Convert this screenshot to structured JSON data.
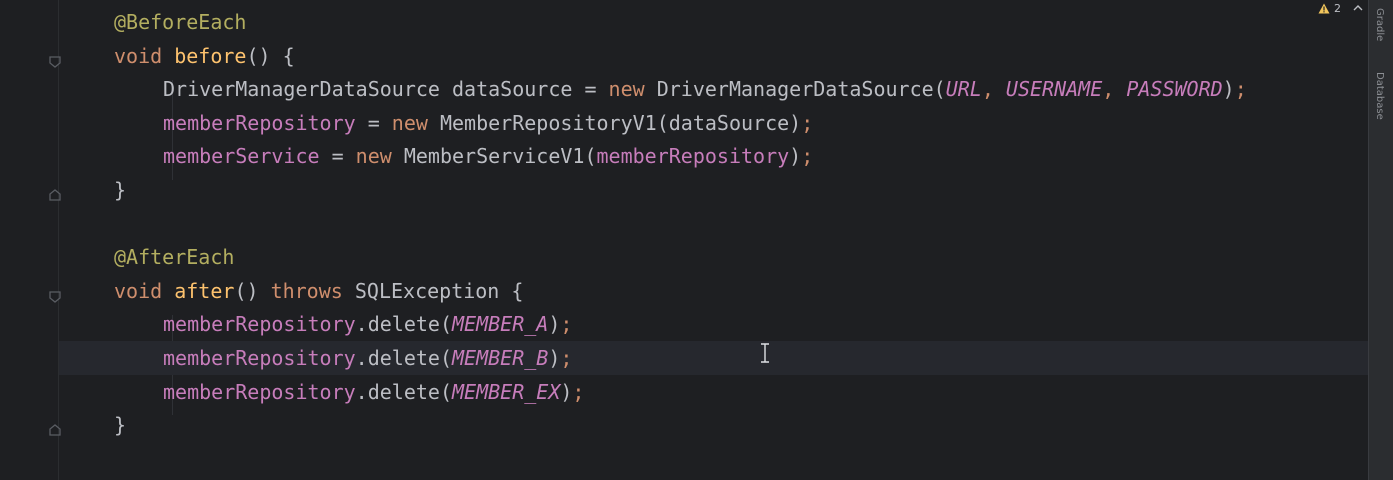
{
  "editor": {
    "inspection": {
      "warning_count": "2"
    },
    "right_toolbar": {
      "labels": [
        "Gradle",
        "Database"
      ]
    },
    "lines": [
      {
        "tokens": [
          {
            "t": "@BeforeEach",
            "c": "annotation"
          }
        ]
      },
      {
        "tokens": [
          {
            "t": "void ",
            "c": "keyword"
          },
          {
            "t": "before",
            "c": "method-decl"
          },
          {
            "t": "() {",
            "c": "punct"
          }
        ]
      },
      {
        "tokens": [
          {
            "t": "DriverManagerDataSource ",
            "c": "plain"
          },
          {
            "t": "dataSource ",
            "c": "plain"
          },
          {
            "t": "= ",
            "c": "plain"
          },
          {
            "t": "new ",
            "c": "keyword"
          },
          {
            "t": "DriverManagerDataSource",
            "c": "plain"
          },
          {
            "t": "(",
            "c": "punct"
          },
          {
            "t": "URL",
            "c": "const"
          },
          {
            "t": ", ",
            "c": "semi"
          },
          {
            "t": "USERNAME",
            "c": "const"
          },
          {
            "t": ", ",
            "c": "semi"
          },
          {
            "t": "PASSWORD",
            "c": "const"
          },
          {
            "t": ")",
            "c": "punct"
          },
          {
            "t": ";",
            "c": "semi"
          }
        ]
      },
      {
        "tokens": [
          {
            "t": "memberRepository ",
            "c": "field"
          },
          {
            "t": "= ",
            "c": "plain"
          },
          {
            "t": "new ",
            "c": "keyword"
          },
          {
            "t": "MemberRepositoryV1",
            "c": "plain"
          },
          {
            "t": "(dataSource)",
            "c": "punct"
          },
          {
            "t": ";",
            "c": "semi"
          }
        ]
      },
      {
        "tokens": [
          {
            "t": "memberService ",
            "c": "field"
          },
          {
            "t": "= ",
            "c": "plain"
          },
          {
            "t": "new ",
            "c": "keyword"
          },
          {
            "t": "MemberServiceV1",
            "c": "plain"
          },
          {
            "t": "(",
            "c": "punct"
          },
          {
            "t": "memberRepository",
            "c": "field"
          },
          {
            "t": ")",
            "c": "punct"
          },
          {
            "t": ";",
            "c": "semi"
          }
        ]
      },
      {
        "tokens": [
          {
            "t": "}",
            "c": "punct"
          }
        ]
      },
      {
        "tokens": []
      },
      {
        "tokens": [
          {
            "t": "@AfterEach",
            "c": "annotation"
          }
        ]
      },
      {
        "tokens": [
          {
            "t": "void ",
            "c": "keyword"
          },
          {
            "t": "after",
            "c": "method-decl"
          },
          {
            "t": "() ",
            "c": "punct"
          },
          {
            "t": "throws ",
            "c": "keyword"
          },
          {
            "t": "SQLException ",
            "c": "plain"
          },
          {
            "t": "{",
            "c": "punct"
          }
        ]
      },
      {
        "tokens": [
          {
            "t": "memberRepository",
            "c": "field"
          },
          {
            "t": ".delete(",
            "c": "punct"
          },
          {
            "t": "MEMBER_A",
            "c": "const"
          },
          {
            "t": ")",
            "c": "punct"
          },
          {
            "t": ";",
            "c": "semi"
          }
        ]
      },
      {
        "tokens": [
          {
            "t": "memberRepository",
            "c": "field"
          },
          {
            "t": ".delete(",
            "c": "punct"
          },
          {
            "t": "MEMBER_B",
            "c": "const"
          },
          {
            "t": ")",
            "c": "punct"
          },
          {
            "t": ";",
            "c": "semi"
          }
        ]
      },
      {
        "tokens": [
          {
            "t": "memberRepository",
            "c": "field"
          },
          {
            "t": ".delete(",
            "c": "punct"
          },
          {
            "t": "MEMBER_EX",
            "c": "const"
          },
          {
            "t": ")",
            "c": "punct"
          },
          {
            "t": ";",
            "c": "semi"
          }
        ]
      },
      {
        "tokens": [
          {
            "t": "}",
            "c": "punct"
          }
        ]
      }
    ],
    "current_line": 10
  }
}
